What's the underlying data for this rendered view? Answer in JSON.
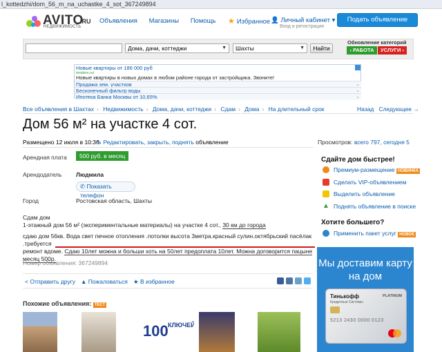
{
  "browser": {
    "url": "l_kottedzhi/dom_56_m_na_uchastke_4_sot_367249894"
  },
  "header": {
    "logo_text": "AVITO",
    "logo_ru": ".RU",
    "logo_sub": "НЕДВИЖИМОСТЬ",
    "nav": [
      "Объявления",
      "Магазины",
      "Помощь"
    ],
    "favorites": "Избранное",
    "cabinet": "Личный кабинет ▾",
    "cabinet_sub": "Вход и регистрация",
    "post_button": "Подать объявление"
  },
  "search": {
    "query": "",
    "category": "Дома, дачи, коттеджи",
    "city": "Шахты",
    "find_button": "Найти",
    "categories_title": "Обновление категорий",
    "work_button": "› РАБОТА",
    "services_button": "УСЛУГИ ›"
  },
  "ads": {
    "top_title": "Новые квартиры от 186 000 руб",
    "top_domain": "tenders.ru/",
    "top_text": "Новые квартиры в новых домах в любом районе города от застройщика. Звоните!",
    "links": [
      "Продажа зем. участков",
      "Бесконечный фильтр воды",
      "Ипотека Банка Москвы от 10,65%"
    ]
  },
  "breadcrumbs": [
    "Все объявления в Шахтах",
    "Недвижимость",
    "Дома, дачи, коттеджи",
    "Сдам",
    "Дома",
    "На длительный срок"
  ],
  "pager": {
    "back": "Назад",
    "next": "Следующее →"
  },
  "listing": {
    "title": "Дом 56 м² на участке 4 сот.",
    "placed": "Размещено 12 июля в 10:36.",
    "edit_link": "Редактировать, закрыть, поднять",
    "edit_suffix": "объявление",
    "views_label": "Просмотров:",
    "views_value": "всего 797, сегодня 5",
    "rent_label": "Арендная плата",
    "rent_value": "500 руб. в месяц",
    "landlord_label": "Арендодатель",
    "landlord_value": "Людмила",
    "phone_button": "Показать телефон",
    "city_label": "Город",
    "city_value": "Ростовская область, Шахты",
    "desc_line1": "Сдам дом",
    "desc_line2a": "1-этажный дом 56 м² (экспериментальные материалы) на участке 4 сот.,",
    "desc_line2b": "30 км до города",
    "desc_line3": "сдаю дом 56кв. Вода свет печное отопления .потолки высота 3метра.красный сулин.октябрьский пасёлак .требуется",
    "desc_line4a": "ремонт вдоме.",
    "desc_line4b": "Сдаю 10лет можна и больши хоть на 50лет предоплата 10лет. Можна договорится пацыне месяц 500р.",
    "ad_number": "Номер объявления: 367249894",
    "share": "Отправить другу",
    "complain": "Пожаловаться",
    "favorite": "В избранное",
    "similar": "Похожие объявления:",
    "similar_badge": "ТЕСТ"
  },
  "sidebar": {
    "sell_title": "Сдайте дом быстрее!",
    "items": [
      "Премиум-размещение",
      "Сделать VIP-объявлением",
      "Выделить объявление",
      "Поднять объявление в поиске"
    ],
    "premium_badge": "НОВИНКА",
    "more_title": "Хотите большего?",
    "package": "Применить пакет услуг",
    "package_badge": "НОВОЕ",
    "banner_text": "Мы доставим карту на дом",
    "card_brand": "Тинькофф",
    "card_sub": "Кредитные Системы",
    "card_tier": "PLATINUM",
    "card_number": "5213 2430 0000 0123"
  },
  "colors": {
    "accent": "#0b5cad",
    "green": "#2e9c2e",
    "red": "#d62222",
    "banner": "#2b85cf"
  }
}
